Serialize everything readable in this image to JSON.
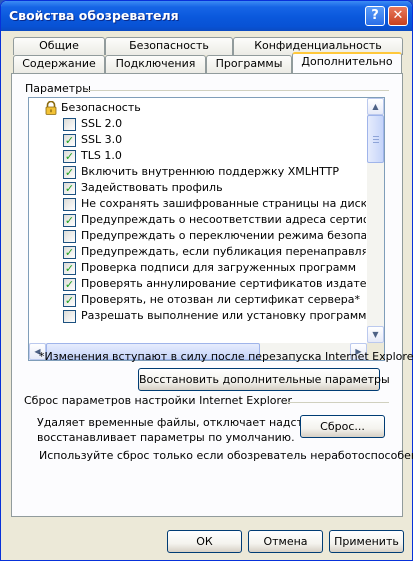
{
  "window": {
    "title": "Свойства обозревателя",
    "help_glyph": "?",
    "close_glyph": "✕"
  },
  "tabs_back": [
    "Общие",
    "Безопасность",
    "Конфиденциальность"
  ],
  "tabs_front": [
    "Содержание",
    "Подключения",
    "Программы",
    "Дополнительно"
  ],
  "active_tab": "Дополнительно",
  "settings": {
    "group_label": "Параметры",
    "category": "Безопасность",
    "category_icon": "lock-icon",
    "items": [
      {
        "label": "SSL 2.0",
        "checked": false
      },
      {
        "label": "SSL 3.0",
        "checked": true
      },
      {
        "label": "TLS 1.0",
        "checked": true
      },
      {
        "label": "Включить внутреннюю поддержку XMLHTTP",
        "checked": true
      },
      {
        "label": "Задействовать профиль",
        "checked": true
      },
      {
        "label": "Не сохранять зашифрованные страницы на диск",
        "checked": false
      },
      {
        "label": "Предупреждать о несоответствии адреса сертификат",
        "checked": true
      },
      {
        "label": "Предупреждать о переключении режима безопасност",
        "checked": false
      },
      {
        "label": "Предупреждать, если публикация перенаправляется в",
        "checked": true
      },
      {
        "label": "Проверка подписи для загруженных программ",
        "checked": true
      },
      {
        "label": "Проверять аннулирование сертификатов издателей",
        "checked": true
      },
      {
        "label": "Проверять, не отозван ли сертификат сервера*",
        "checked": true
      },
      {
        "label": "Разрешать выполнение или установку программы, име",
        "checked": false
      }
    ],
    "note": "*Изменения вступают в силу после перезапуска Internet Explorer",
    "restore_button": "Восстановить дополнительные параметры"
  },
  "reset": {
    "group_label": "Сброс параметров настройки Internet Explorer",
    "description_line1": "Удаляет временные файлы, отключает надстройки,",
    "description_line2": "восстанавливает параметры по умолчанию.",
    "reset_button": "Сброс...",
    "hint": "Используйте сброс только если обозреватель неработоспособен."
  },
  "footer": {
    "ok": "ОК",
    "cancel": "Отмена",
    "apply": "Применить"
  }
}
